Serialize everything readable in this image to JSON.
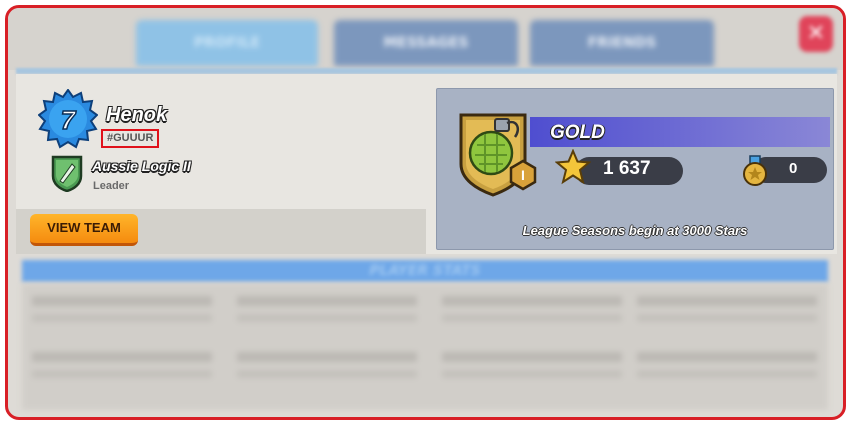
{
  "tabs": [
    {
      "label": "PROFILE",
      "active": true
    },
    {
      "label": "MESSAGES",
      "active": false
    },
    {
      "label": "FRIENDS",
      "active": false
    }
  ],
  "close_icon": "close-icon",
  "player": {
    "level": "7",
    "name": "Henok",
    "tag": "#GUUUR"
  },
  "team": {
    "name": "Aussie Logic II",
    "role": "Leader",
    "view_button": "VIEW TEAM"
  },
  "league": {
    "rank": "GOLD",
    "division": "I",
    "stars": "1 637",
    "medals": "0",
    "note": "League Seasons begin at 3000 Stars"
  },
  "stats": {
    "header": "PLAYER STATS"
  },
  "colors": {
    "frame_border": "#d81f26",
    "accent_orange": "#f58b0f",
    "gold_band": "#4f4ed0",
    "stats_header": "#6ea7e8"
  }
}
